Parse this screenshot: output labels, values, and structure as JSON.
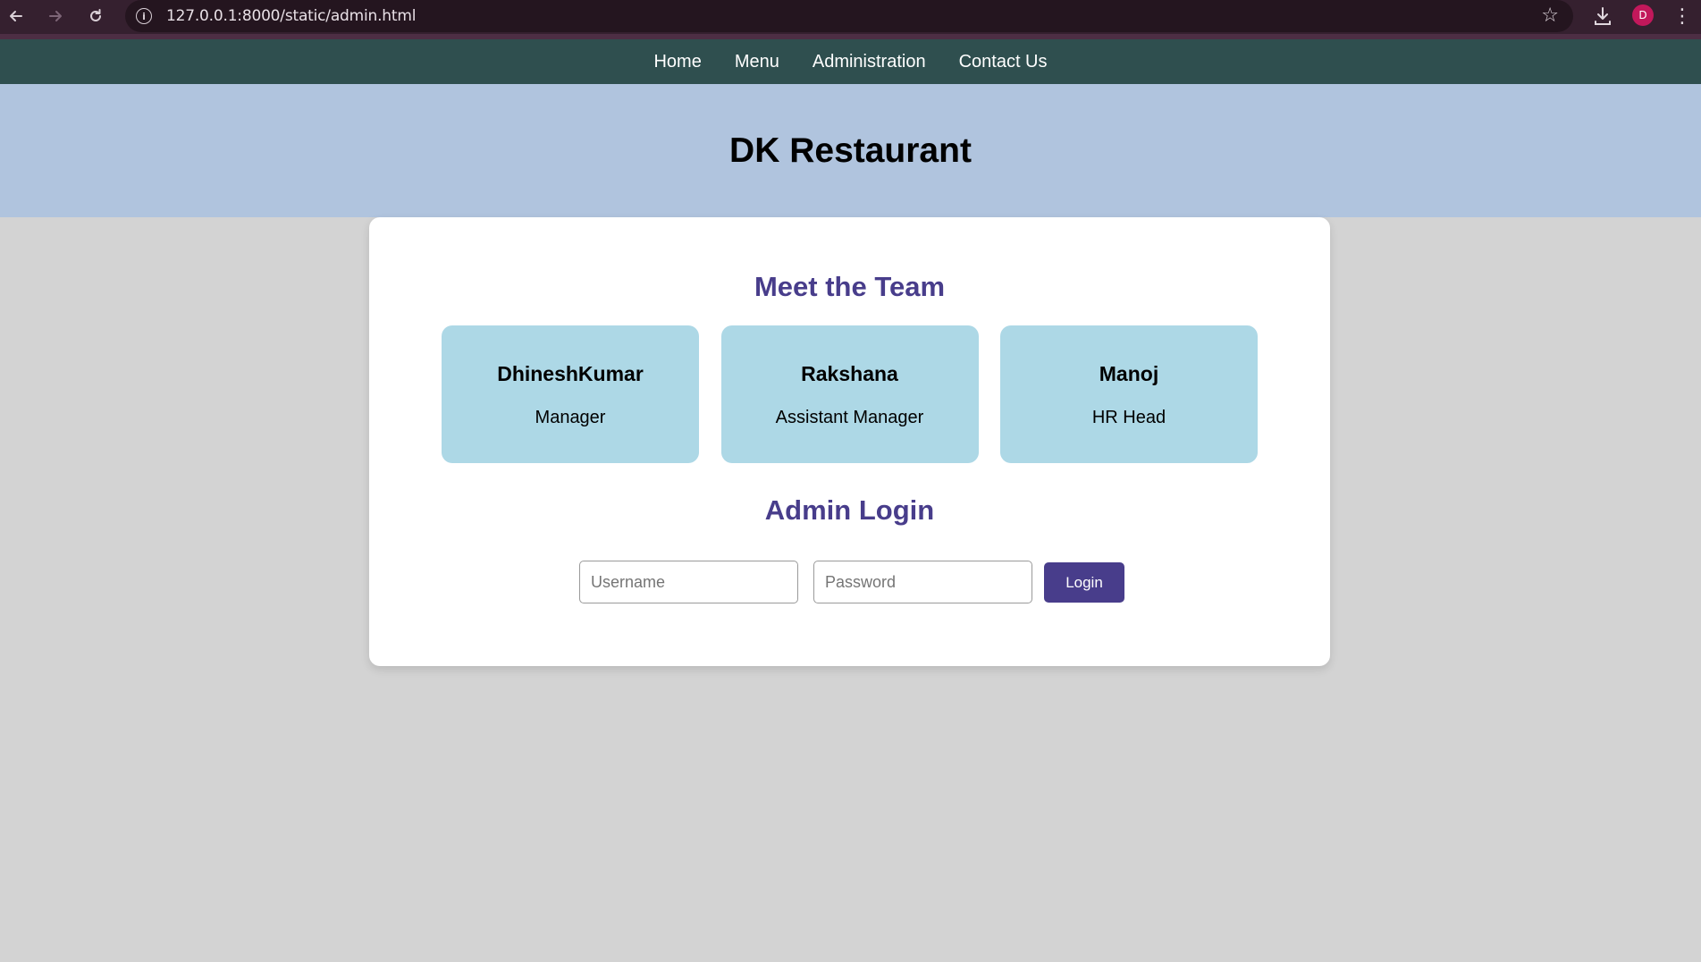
{
  "browser": {
    "url": "127.0.0.1:8000/static/admin.html",
    "avatar_initial": "D"
  },
  "nav": {
    "items": [
      {
        "label": "Home"
      },
      {
        "label": "Menu"
      },
      {
        "label": "Administration"
      },
      {
        "label": "Contact Us"
      }
    ]
  },
  "header": {
    "title": "DK Restaurant"
  },
  "team": {
    "title": "Meet the Team",
    "members": [
      {
        "name": "DhineshKumar",
        "role": "Manager"
      },
      {
        "name": "Rakshana",
        "role": "Assistant Manager"
      },
      {
        "name": "Manoj",
        "role": "HR Head"
      }
    ]
  },
  "login": {
    "title": "Admin Login",
    "username_placeholder": "Username",
    "password_placeholder": "Password",
    "username_value": "",
    "password_value": "",
    "button_label": "Login"
  },
  "colors": {
    "nav_bg": "#2f4f4f",
    "header_bg": "#b0c4de",
    "page_bg": "#d3d3d3",
    "accent": "#483d8b",
    "member_card_bg": "#add8e6"
  }
}
